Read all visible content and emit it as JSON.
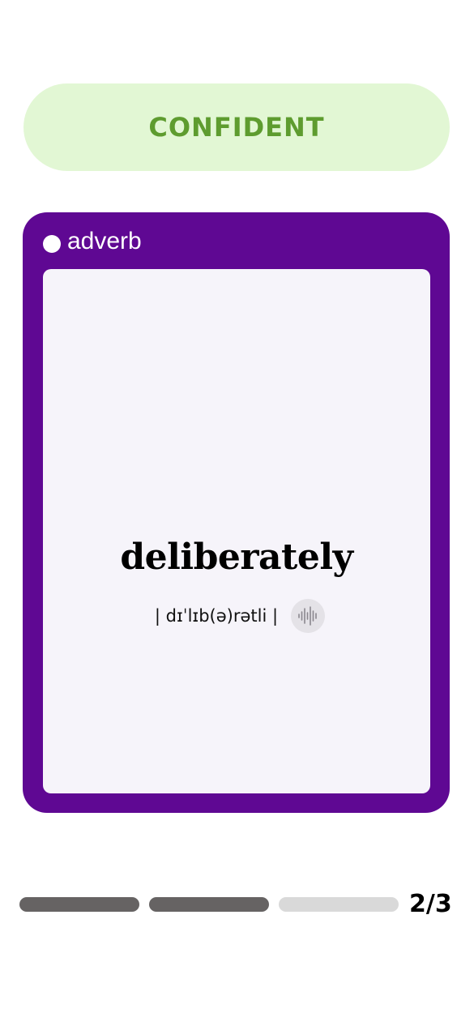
{
  "status": {
    "label": "CONFIDENT",
    "bg_color": "#e2f7d4",
    "text_color": "#5e9c2f"
  },
  "card": {
    "color": "#5f0893",
    "part_of_speech": "adverb",
    "word": "deliberately",
    "phonetic": "| dɪˈlɪb(ə)rətli |",
    "audio_icon": "sound-wave-icon"
  },
  "progress": {
    "counter": "2/3",
    "current": 2,
    "total": 3
  }
}
